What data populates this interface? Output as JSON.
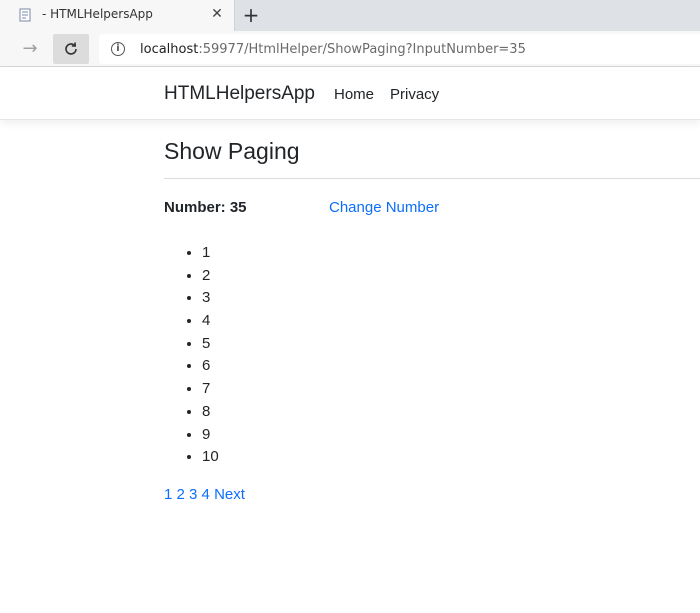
{
  "browser": {
    "tab_title": "- HTMLHelpersApp",
    "url_host": "localhost",
    "url_rest": ":59977/HtmlHelper/ShowPaging?InputNumber=35"
  },
  "header": {
    "brand": "HTMLHelpersApp",
    "nav": [
      {
        "label": "Home"
      },
      {
        "label": "Privacy"
      }
    ]
  },
  "main": {
    "title": "Show Paging",
    "number_label": "Number: 35",
    "change_link": "Change Number",
    "items": [
      "1",
      "2",
      "3",
      "4",
      "5",
      "6",
      "7",
      "8",
      "9",
      "10"
    ],
    "pager": [
      "1",
      "2",
      "3",
      "4",
      "Next"
    ]
  },
  "colors": {
    "link": "#0d6efd",
    "text": "#212529"
  },
  "icons": [
    "page-icon",
    "close-icon",
    "plus-icon",
    "arrow-right-icon",
    "reload-icon",
    "info-icon"
  ]
}
